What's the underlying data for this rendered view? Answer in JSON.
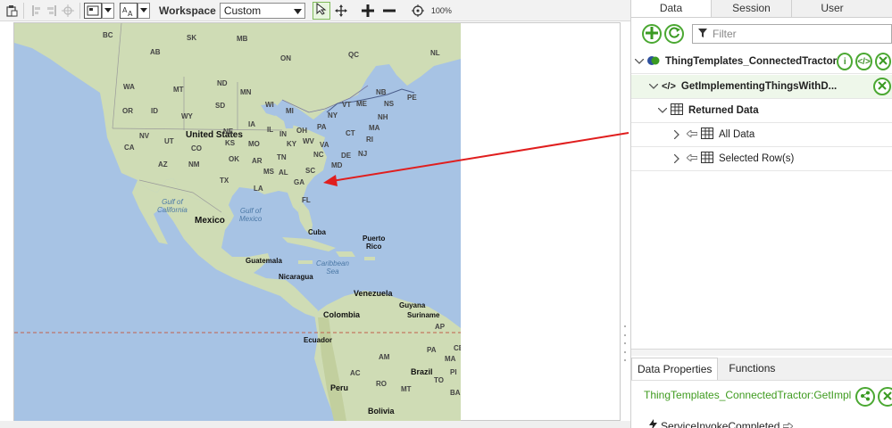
{
  "toolbar": {
    "workspace_label": "Workspace",
    "workspace_value": "Custom",
    "zoom_label": "100%"
  },
  "tabs": [
    {
      "label": "Data"
    },
    {
      "label": "Session"
    },
    {
      "label": "User"
    }
  ],
  "filter": {
    "placeholder": "Filter"
  },
  "tree": {
    "thing_template": "ThingTemplates_ConnectedTractor",
    "service": "GetImplementingThingsWithD...",
    "returned": "Returned Data",
    "all_data": "All Data",
    "selected_rows": "Selected Row(s)"
  },
  "bottom_tabs": [
    {
      "label": "Data Properties"
    },
    {
      "label": "Functions"
    }
  ],
  "data_properties": {
    "path": "ThingTemplates_ConnectedTractor:GetImpl...",
    "event": "ServiceInvokeCompleted"
  },
  "map": {
    "regions": {
      "us": "United States",
      "mexico": "Mexico",
      "cuba": "Cuba",
      "puerto_rico": "Puerto\nRico",
      "guatemala": "Guatemala",
      "nicaragua": "Nicaragua",
      "venezuela": "Venezuela",
      "colombia": "Colombia",
      "ecuador": "Ecuador",
      "guyana": "Guyana",
      "suriname": "Suriname",
      "peru": "Peru",
      "brazil": "Brazil",
      "bolivia": "Bolivia"
    },
    "water": {
      "gulf_california": "Gulf of\nCalifornia",
      "gulf_mexico": "Gulf of\nMexico",
      "caribbean": "Caribbean\nSea"
    },
    "states": [
      "BC",
      "SK",
      "MB",
      "ON",
      "QC",
      "NL",
      "AB",
      "WA",
      "MT",
      "ND",
      "MN",
      "OR",
      "ID",
      "WY",
      "SD",
      "WI",
      "MI",
      "NB",
      "NS",
      "PE",
      "VT",
      "ME",
      "NH",
      "NY",
      "MA",
      "NV",
      "UT",
      "CO",
      "NE",
      "IA",
      "IL",
      "IN",
      "OH",
      "PA",
      "CT",
      "RI",
      "CA",
      "KS",
      "MO",
      "KY",
      "WV",
      "VA",
      "NJ",
      "DE",
      "MD",
      "AZ",
      "NM",
      "OK",
      "AR",
      "TN",
      "NC",
      "SC",
      "TX",
      "MS",
      "AL",
      "GA",
      "LA",
      "FL",
      "AP",
      "AM",
      "PA",
      "AC",
      "RO",
      "MT",
      "TO",
      "BA",
      "MA",
      "PI",
      "CE",
      "PE"
    ]
  },
  "colors": {
    "accent_green": "#4ba832",
    "arrow": "#e01e1e",
    "land": "#cfdcb5",
    "water": "#a7c3e4"
  },
  "icons": [
    "select-icon",
    "pan-icon",
    "zoom-in-icon",
    "zoom-out-icon",
    "target-icon",
    "add-icon",
    "refresh-icon",
    "filter-icon",
    "info-icon",
    "code-icon",
    "close-icon",
    "table-icon",
    "arrow-left-icon",
    "bolt-icon",
    "share-icon"
  ]
}
